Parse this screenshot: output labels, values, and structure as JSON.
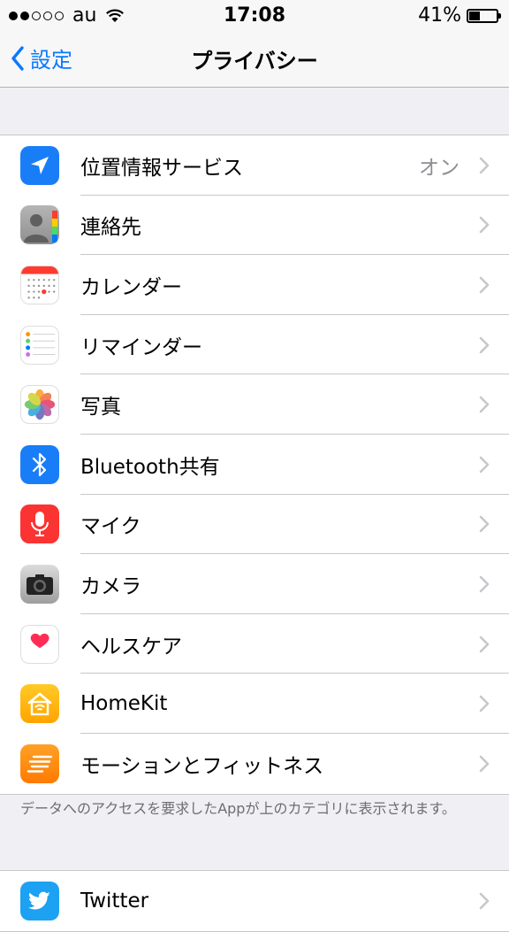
{
  "status_bar": {
    "carrier": "au",
    "time": "17:08",
    "battery_percent": "41%",
    "battery_level": 0.41,
    "signal_bars": 2
  },
  "nav": {
    "back_label": "設定",
    "title": "プライバシー"
  },
  "privacy_items": [
    {
      "label": "位置情報サービス",
      "value": "オン",
      "icon": "location-arrow-icon",
      "color": "#1a7df8"
    },
    {
      "label": "連絡先",
      "value": "",
      "icon": "contacts-icon",
      "color": "#9a9a9a"
    },
    {
      "label": "カレンダー",
      "value": "",
      "icon": "calendar-icon",
      "color": "#ffffff"
    },
    {
      "label": "リマインダー",
      "value": "",
      "icon": "reminders-icon",
      "color": "#ffffff"
    },
    {
      "label": "写真",
      "value": "",
      "icon": "photos-icon",
      "color": "#ffffff"
    },
    {
      "label": "Bluetooth共有",
      "value": "",
      "icon": "bluetooth-icon",
      "color": "#1a7df8"
    },
    {
      "label": "マイク",
      "value": "",
      "icon": "microphone-icon",
      "color": "#fb3333"
    },
    {
      "label": "カメラ",
      "value": "",
      "icon": "camera-icon",
      "color": "#8e8e93"
    },
    {
      "label": "ヘルスケア",
      "value": "",
      "icon": "health-heart-icon",
      "color": "#ffffff"
    },
    {
      "label": "HomeKit",
      "value": "",
      "icon": "homekit-icon",
      "color": "#ffb400"
    },
    {
      "label": "モーションとフィットネス",
      "value": "",
      "icon": "motion-fitness-icon",
      "color": "#ff8a00"
    }
  ],
  "footer_note": "データへのアクセスを要求したAppが上のカテゴリに表示されます。",
  "apps": [
    {
      "label": "Twitter",
      "icon": "twitter-icon",
      "color": "#1da1f2"
    }
  ]
}
